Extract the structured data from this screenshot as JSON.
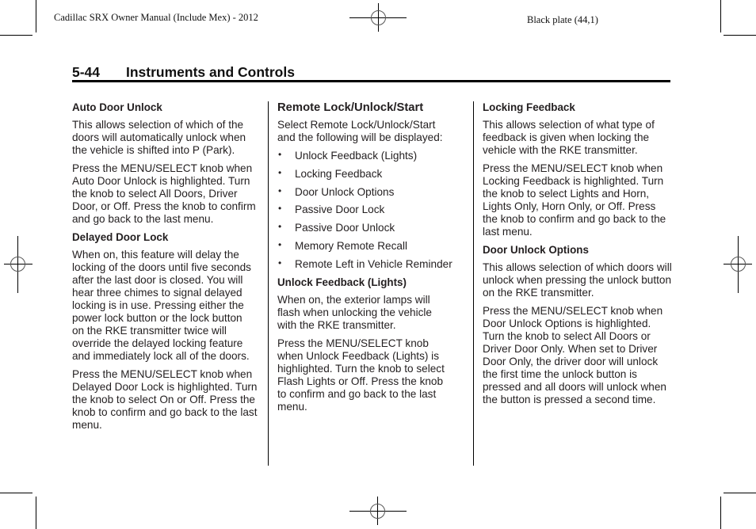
{
  "header": {
    "left_text": "Cadillac SRX Owner Manual (Include Mex) - 2012",
    "right_text": "Black plate (44,1)"
  },
  "page": {
    "number": "5-44",
    "section": "Instruments and Controls"
  },
  "columns": [
    {
      "blocks": [
        {
          "type": "heading",
          "text": "Auto Door Unlock"
        },
        {
          "type": "paragraph",
          "text": "This allows selection of which of the doors will automatically unlock when the vehicle is shifted into P (Park)."
        },
        {
          "type": "paragraph",
          "text": "Press the MENU/SELECT knob when Auto Door Unlock is highlighted. Turn the knob to select All Doors, Driver Door, or Off. Press the knob to confirm and go back to the last menu."
        },
        {
          "type": "heading",
          "text": "Delayed Door Lock"
        },
        {
          "type": "paragraph",
          "text": "When on, this feature will delay the locking of the doors until five seconds after the last door is closed. You will hear three chimes to signal delayed locking is in use. Pressing either the power lock button or the lock button on the RKE transmitter twice will override the delayed locking feature and immediately lock all of the doors."
        },
        {
          "type": "paragraph",
          "text": "Press the MENU/SELECT knob when Delayed Door Lock is highlighted. Turn the knob to select On or Off. Press the knob to confirm and go back to the last menu."
        }
      ]
    },
    {
      "blocks": [
        {
          "type": "title",
          "text": "Remote Lock/Unlock/Start"
        },
        {
          "type": "paragraph",
          "text": "Select Remote Lock/Unlock/Start and the following will be displayed:"
        },
        {
          "type": "list",
          "items": [
            "Unlock Feedback (Lights)",
            "Locking Feedback",
            "Door Unlock Options",
            "Passive Door Lock",
            "Passive Door Unlock",
            "Memory Remote Recall",
            "Remote Left in Vehicle Reminder"
          ]
        },
        {
          "type": "heading",
          "text": "Unlock Feedback (Lights)"
        },
        {
          "type": "paragraph",
          "text": "When on, the exterior lamps will flash when unlocking the vehicle with the RKE transmitter."
        },
        {
          "type": "paragraph",
          "text": "Press the MENU/SELECT knob when Unlock Feedback (Lights) is highlighted. Turn the knob to select Flash Lights or Off. Press the knob to confirm and go back to the last menu."
        }
      ]
    },
    {
      "blocks": [
        {
          "type": "heading",
          "text": "Locking Feedback"
        },
        {
          "type": "paragraph",
          "text": "This allows selection of what type of feedback is given when locking the vehicle with the RKE transmitter."
        },
        {
          "type": "paragraph",
          "text": "Press the MENU/SELECT knob when Locking Feedback is highlighted. Turn the knob to select Lights and Horn, Lights Only, Horn Only, or Off. Press the knob to confirm and go back to the last menu."
        },
        {
          "type": "heading",
          "text": "Door Unlock Options"
        },
        {
          "type": "paragraph",
          "text": "This allows selection of which doors will unlock when pressing the unlock button on the RKE transmitter."
        },
        {
          "type": "paragraph",
          "text": "Press the MENU/SELECT knob when Door Unlock Options is highlighted. Turn the knob to select All Doors or Driver Door Only. When set to Driver Door Only, the driver door will unlock the first time the unlock button is pressed and all doors will unlock when the button is pressed a second time."
        }
      ]
    }
  ]
}
